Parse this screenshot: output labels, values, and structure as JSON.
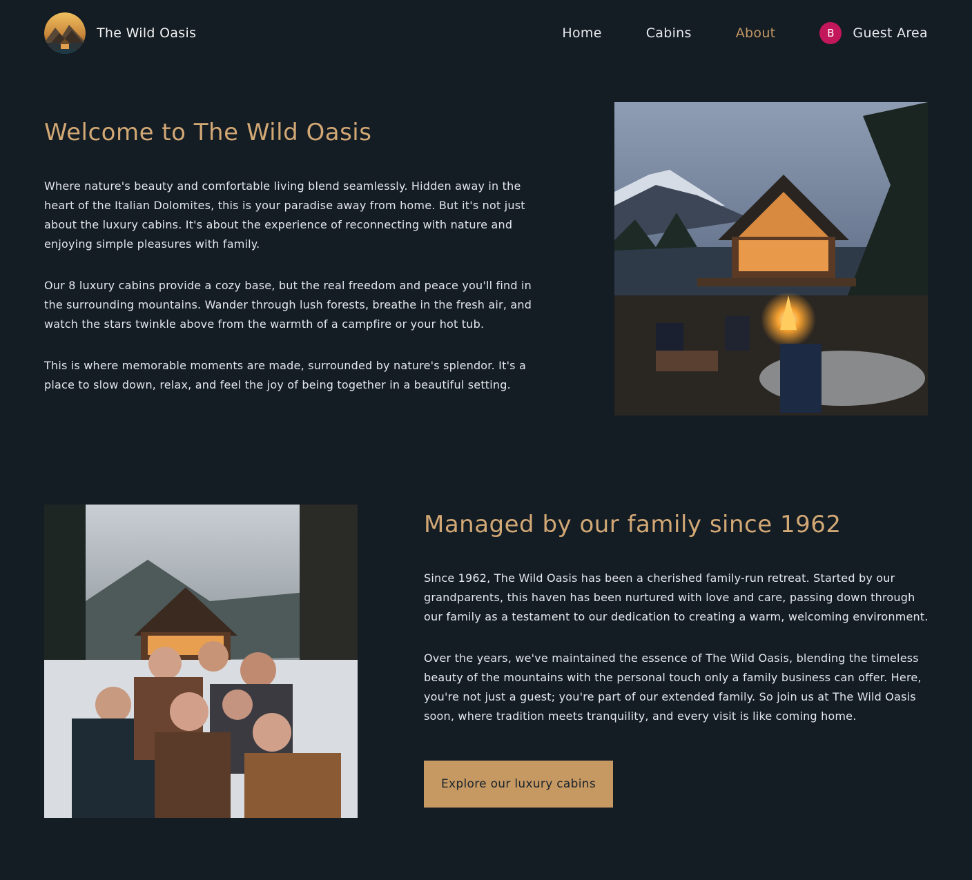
{
  "header": {
    "brand_name": "The Wild Oasis",
    "logo_icon": "mountain-cabin-logo",
    "nav": [
      {
        "label": "Home",
        "active": false
      },
      {
        "label": "Cabins",
        "active": false
      },
      {
        "label": "About",
        "active": true
      }
    ],
    "guest": {
      "avatar_initial": "B",
      "label": "Guest Area",
      "avatar_color": "#c2185b"
    }
  },
  "welcome": {
    "title": "Welcome to The Wild Oasis",
    "paragraphs": [
      "Where nature's beauty and comfortable living blend seamlessly. Hidden away in the heart of the Italian Dolomites, this is your paradise away from home. But it's not just about the luxury cabins. It's about the experience of reconnecting with nature and enjoying simple pleasures with family.",
      "Our 8 luxury cabins provide a cozy base, but the real freedom and peace you'll find in the surrounding mountains. Wander through lush forests, breathe in the fresh air, and watch the stars twinkle above from the warmth of a campfire or your hot tub.",
      "This is where memorable moments are made, surrounded by nature's splendor. It's a place to slow down, relax, and feel the joy of being together in a beautiful setting."
    ]
  },
  "family": {
    "title": "Managed by our family since 1962",
    "paragraphs": [
      "Since 1962, The Wild Oasis has been a cherished family-run retreat. Started by our grandparents, this haven has been nurtured with love and care, passing down through our family as a testament to our dedication to creating a warm, welcoming environment.",
      "Over the years, we've maintained the essence of The Wild Oasis, blending the timeless beauty of the mountains with the personal touch only a family business can offer. Here, you're not just a guest; you're part of our extended family. So join us at The Wild Oasis soon, where tradition meets tranquility, and every visit is like coming home."
    ],
    "cta_label": "Explore our luxury cabins"
  },
  "colors": {
    "background": "#141c24",
    "accent": "#c69963",
    "heading": "#d2a875",
    "text": "#e4e8ec"
  }
}
